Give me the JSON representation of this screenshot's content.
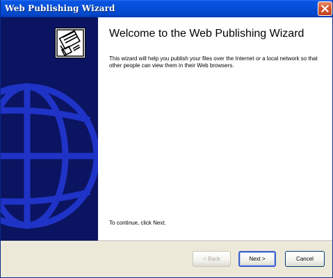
{
  "window": {
    "title": "Web Publishing Wizard",
    "close_label": "×"
  },
  "content": {
    "heading": "Welcome to the Web Publishing Wizard",
    "description": "This wizard will help you publish your files over the Internet or a local network so that other people can view them in their Web browsers.",
    "continue_text": "To continue, click Next."
  },
  "buttons": {
    "back": "< Back",
    "next": "Next >",
    "cancel": "Cancel"
  },
  "colors": {
    "titlebar": "#0450d9",
    "sidepanel": "#0b1460",
    "globe": "#1f33c7",
    "dialog_face": "#ece9d8"
  },
  "icons": {
    "wizard": "publish-wizard-icon",
    "globe": "globe-graphic",
    "close": "close-icon"
  }
}
